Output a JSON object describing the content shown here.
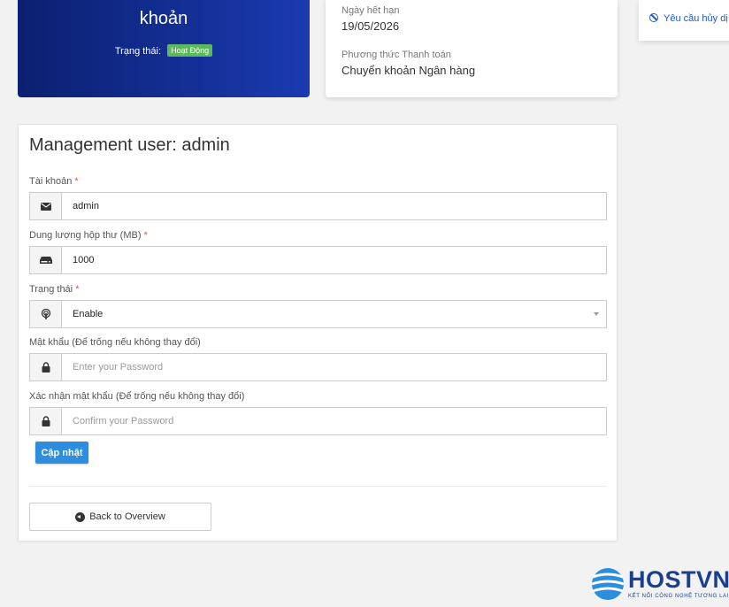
{
  "account_card": {
    "title": "khoản",
    "status_label": "Trạng thái:",
    "status_badge": "Hoạt Động"
  },
  "info_card": {
    "expiry_label": "Ngày hết hạn",
    "expiry_value": "19/05/2026",
    "payment_label": "Phương thức Thanh toán",
    "payment_value": "Chuyển khoản Ngân hàng"
  },
  "side_card": {
    "cancel_link": "Yêu cầu hủy dị"
  },
  "form": {
    "heading": "Management user: admin",
    "account": {
      "label": "Tài khoản",
      "required": "*",
      "value": "admin",
      "icon": "envelope-icon"
    },
    "quota": {
      "label": "Dung lượng hộp thư (MB)",
      "required": "*",
      "value": "1000",
      "icon": "hdd-icon"
    },
    "status": {
      "label": "Trạng thái",
      "required": "*",
      "value": "Enable",
      "icon": "podcast-icon"
    },
    "password": {
      "label": "Mật khẩu (Để trống nếu không thay đổi)",
      "placeholder": "Enter your Password",
      "icon": "lock-icon"
    },
    "confirm": {
      "label": "Xác nhận mật khẩu (Để trống nếu không thay đổi)",
      "placeholder": "Confirm your Password",
      "icon": "lock-icon"
    },
    "update_button": "Cập nhật",
    "back_button": "Back to Overview"
  },
  "logo": {
    "brand": "HOSTVN",
    "tagline": "KẾT NỐI CÔNG NGHỆ TƯƠNG LAI"
  },
  "colors": {
    "primary": "#2d8ee0",
    "card_gradient_start": "#0b2070",
    "card_gradient_end": "#1a3ab0",
    "badge_green": "#5cb85c",
    "required_red": "#d9534f",
    "brand_blue": "#1a3f8f"
  }
}
